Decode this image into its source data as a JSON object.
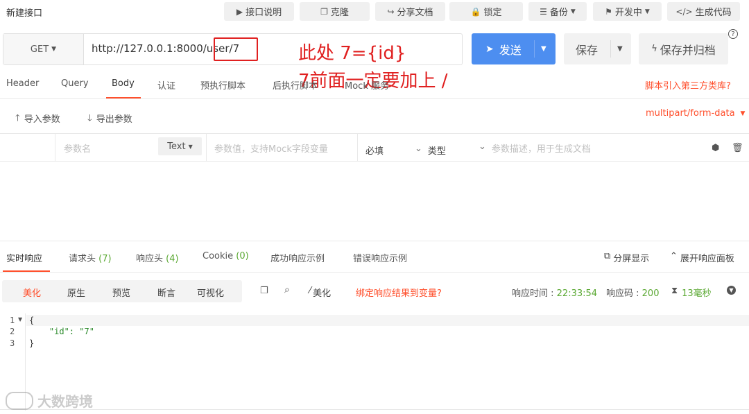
{
  "header": {
    "title": "新建接口",
    "buttons": {
      "doc": "接口说明",
      "clone": "克隆",
      "share": "分享文档",
      "lock": "锁定",
      "backup": "备份",
      "status": "开发中",
      "gencode": "生成代码"
    }
  },
  "request": {
    "method": "GET",
    "url": "http://127.0.0.1:8000/user/7",
    "send": "发送",
    "save": "保存",
    "save_archive": "保存并归档"
  },
  "annotation": {
    "line1": "此处 7={id}",
    "line2": "7前面一定要加上 /"
  },
  "tabs": [
    "Header",
    "Query",
    "Body",
    "认证",
    "预执行脚本",
    "后执行脚本",
    "Mock 服务"
  ],
  "active_tab": "Body",
  "library_link": "脚本引入第三方类库?",
  "body_toolbar": {
    "import": "导入参数",
    "export": "导出参数",
    "content_type": "multipart/form-data"
  },
  "param_row": {
    "name_placeholder": "参数名",
    "type": "Text",
    "value_placeholder": "参数值，支持Mock字段变量",
    "required": "必填",
    "field_type": "类型",
    "desc_placeholder": "参数描述，用于生成文档"
  },
  "response_tabs": {
    "realtime": "实时响应",
    "req_headers": "请求头",
    "req_headers_count": "(7)",
    "resp_headers": "响应头",
    "resp_headers_count": "(4)",
    "cookie": "Cookie",
    "cookie_count": "(0)",
    "success_example": "成功响应示例",
    "error_example": "错误响应示例",
    "split": "分屏显示",
    "expand": "展开响应面板"
  },
  "view_modes": [
    "美化",
    "原生",
    "预览",
    "断言",
    "可视化"
  ],
  "active_view": "美化",
  "resp_toolbar": {
    "beautify": "美化",
    "bind_link": "绑定响应结果到变量?",
    "time_label": "响应时间 :",
    "time_value": "22:33:54",
    "code_label": "响应码 :",
    "code_value": "200",
    "duration": "13毫秒"
  },
  "code_lines": [
    {
      "num": "1",
      "text": "{"
    },
    {
      "num": "2",
      "text": "    \"id\": \"7\""
    },
    {
      "num": "3",
      "text": "}"
    }
  ],
  "watermark": "大数跨境",
  "colors": {
    "accent": "#ff4f2c",
    "primary": "#4d8ef0",
    "annotation": "#e02020",
    "green": "#5aa832"
  }
}
